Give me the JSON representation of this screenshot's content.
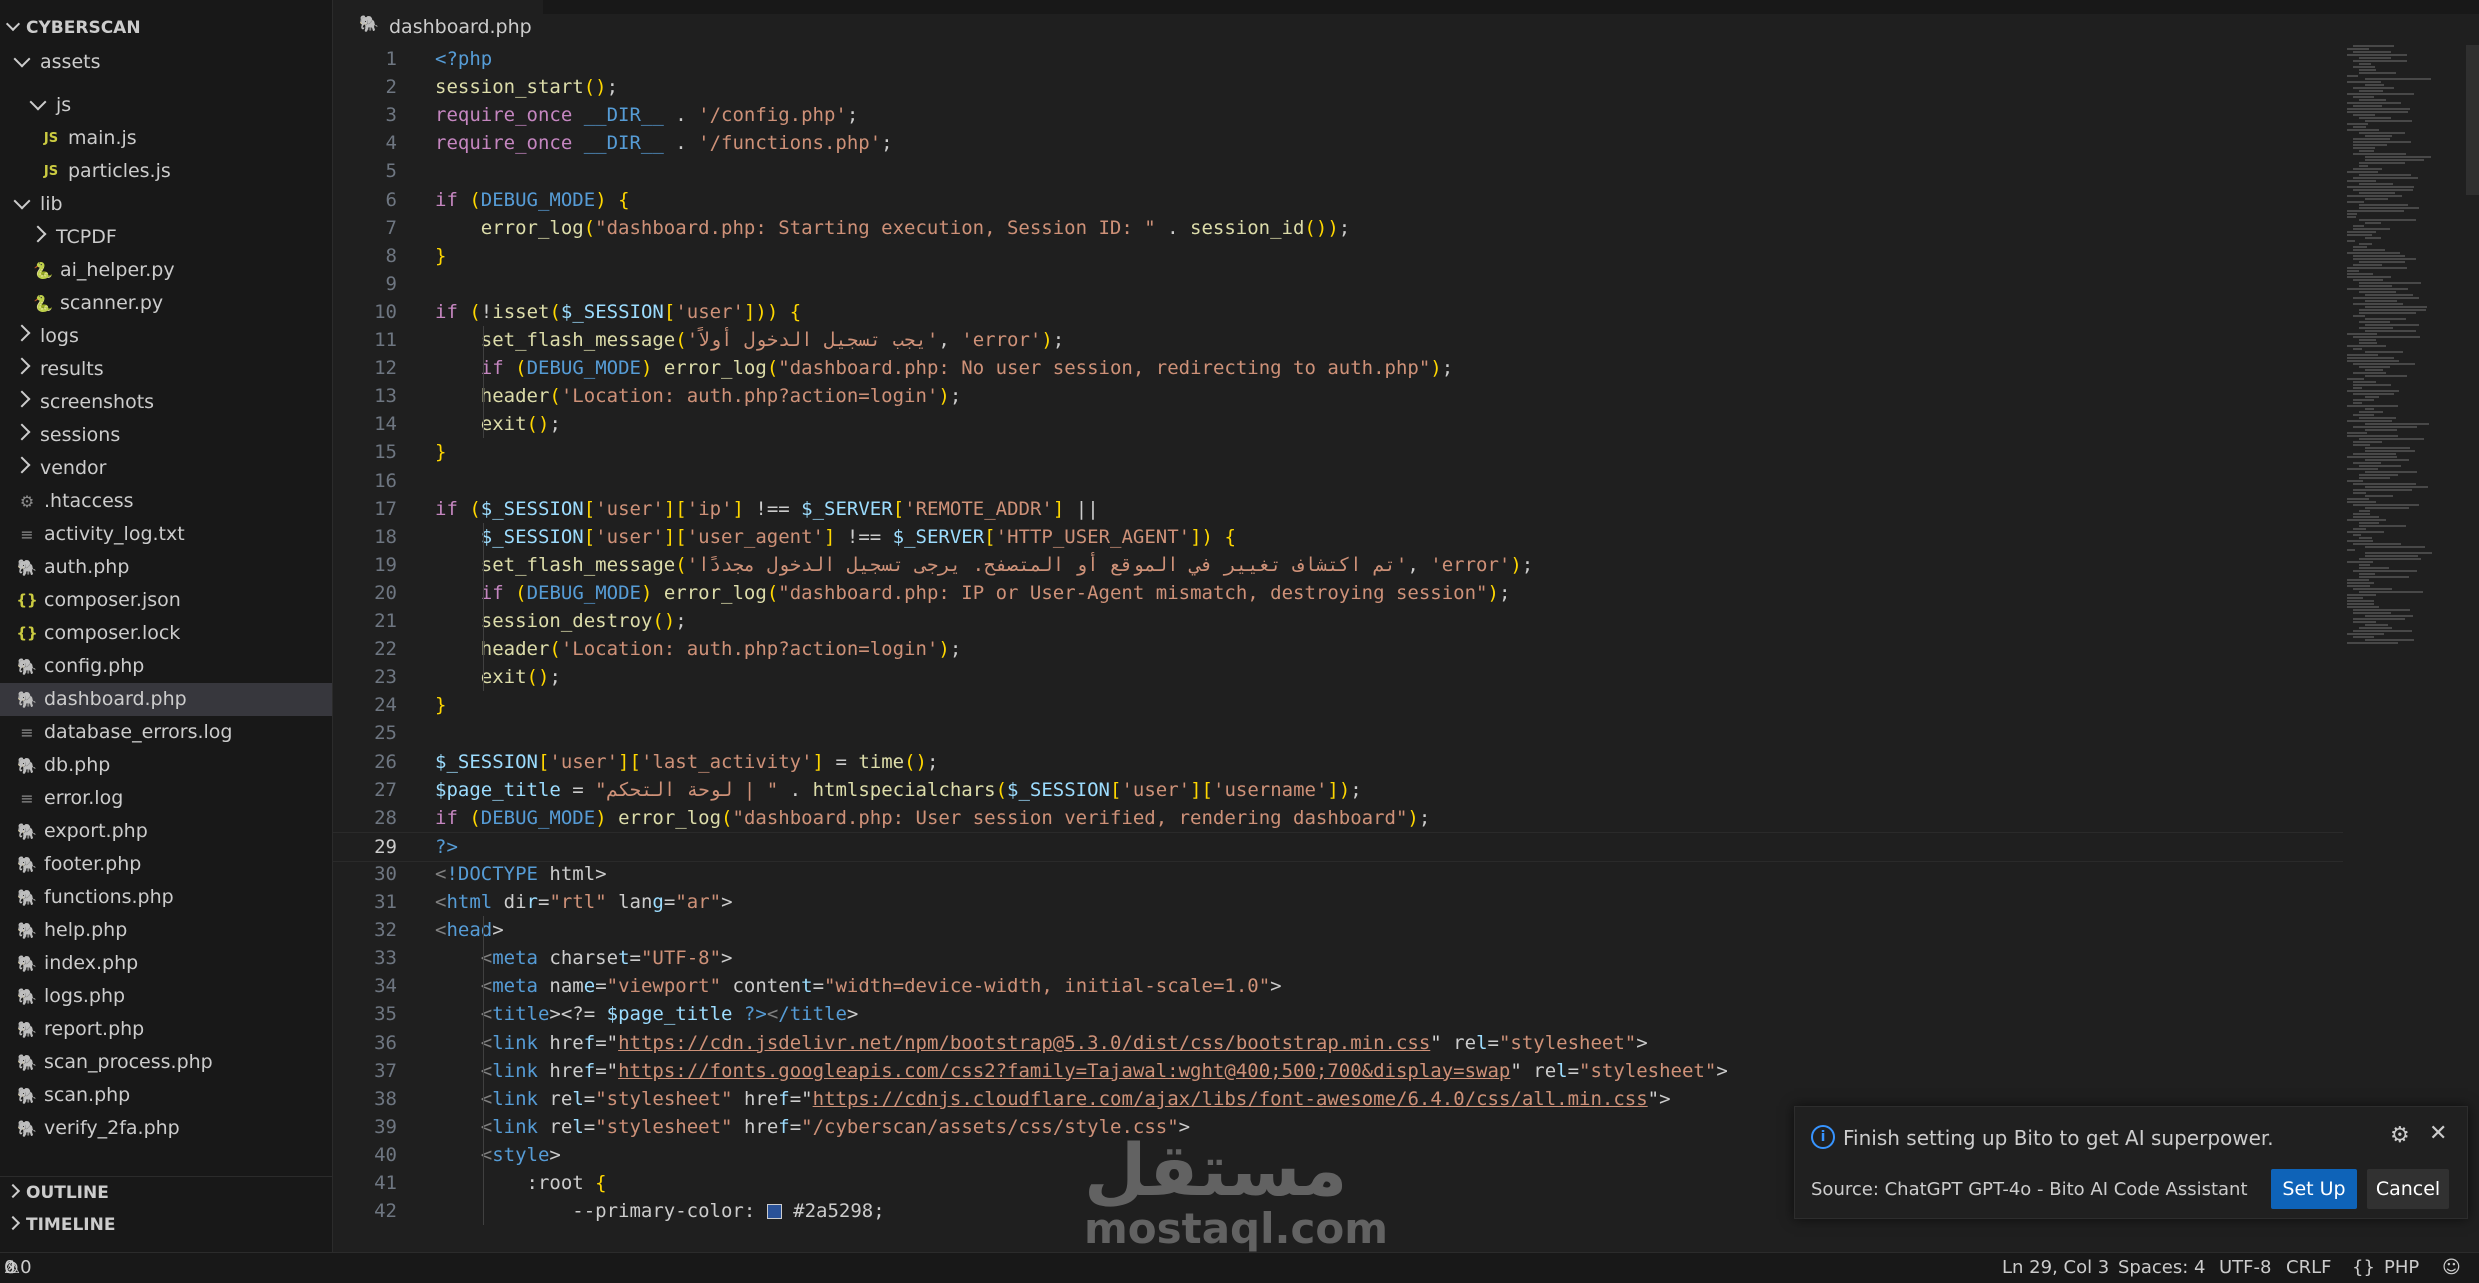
{
  "sidebar": {
    "root": "CYBERSCAN",
    "items": [
      {
        "label": "assets",
        "kind": "folder-open"
      },
      {
        "label": "js",
        "kind": "folder-open"
      },
      {
        "label": "main.js",
        "kind": "js"
      },
      {
        "label": "particles.js",
        "kind": "js"
      },
      {
        "label": "lib",
        "kind": "folder-open"
      },
      {
        "label": "TCPDF",
        "kind": "folder"
      },
      {
        "label": "ai_helper.py",
        "kind": "py"
      },
      {
        "label": "scanner.py",
        "kind": "py"
      },
      {
        "label": "logs",
        "kind": "folder"
      },
      {
        "label": "results",
        "kind": "folder"
      },
      {
        "label": "screenshots",
        "kind": "folder"
      },
      {
        "label": "sessions",
        "kind": "folder"
      },
      {
        "label": "vendor",
        "kind": "folder"
      },
      {
        "label": ".htaccess",
        "kind": "gear"
      },
      {
        "label": "activity_log.txt",
        "kind": "text"
      },
      {
        "label": "auth.php",
        "kind": "php"
      },
      {
        "label": "composer.json",
        "kind": "json"
      },
      {
        "label": "composer.lock",
        "kind": "json"
      },
      {
        "label": "config.php",
        "kind": "php"
      },
      {
        "label": "dashboard.php",
        "kind": "php"
      },
      {
        "label": "database_errors.log",
        "kind": "text"
      },
      {
        "label": "db.php",
        "kind": "php"
      },
      {
        "label": "error.log",
        "kind": "text"
      },
      {
        "label": "export.php",
        "kind": "php"
      },
      {
        "label": "footer.php",
        "kind": "php"
      },
      {
        "label": "functions.php",
        "kind": "php"
      },
      {
        "label": "help.php",
        "kind": "php"
      },
      {
        "label": "index.php",
        "kind": "php"
      },
      {
        "label": "logs.php",
        "kind": "php"
      },
      {
        "label": "report.php",
        "kind": "php"
      },
      {
        "label": "scan_process.php",
        "kind": "php"
      },
      {
        "label": "scan.php",
        "kind": "php"
      },
      {
        "label": "verify_2fa.php",
        "kind": "php"
      }
    ],
    "selected": "dashboard.php",
    "outline_label": "OUTLINE",
    "timeline_label": "TIMELINE"
  },
  "editor": {
    "tab_label": "dashboard.php",
    "current_line": 29,
    "lines": [
      "<?php",
      "session_start();",
      "require_once __DIR__ . '/config.php';",
      "require_once __DIR__ . '/functions.php';",
      "",
      "if (DEBUG_MODE) {",
      "    error_log(\"dashboard.php: Starting execution, Session ID: \" . session_id());",
      "}",
      "",
      "if (!isset($_SESSION['user'])) {",
      "    set_flash_message('يجب تسجيل الدخول أولاً', 'error');",
      "    if (DEBUG_MODE) error_log(\"dashboard.php: No user session, redirecting to auth.php\");",
      "    header('Location: auth.php?action=login');",
      "    exit();",
      "}",
      "",
      "if ($_SESSION['user']['ip'] !== $_SERVER['REMOTE_ADDR'] ||",
      "    $_SESSION['user']['user_agent'] !== $_SERVER['HTTP_USER_AGENT']) {",
      "    set_flash_message('تم اكتشاف تغيير في الموقع أو المتصفح. يرجى تسجيل الدخول مجددًا', 'error');",
      "    if (DEBUG_MODE) error_log(\"dashboard.php: IP or User-Agent mismatch, destroying session\");",
      "    session_destroy();",
      "    header('Location: auth.php?action=login');",
      "    exit();",
      "}",
      "",
      "$_SESSION['user']['last_activity'] = time();",
      "$page_title = \"لوحة التحكم | \" . htmlspecialchars($_SESSION['user']['username']);",
      "if (DEBUG_MODE) error_log(\"dashboard.php: User session verified, rendering dashboard\");",
      "?>",
      "<!DOCTYPE html>",
      "<html dir=\"rtl\" lang=\"ar\">",
      "<head>",
      "    <meta charset=\"UTF-8\">",
      "    <meta name=\"viewport\" content=\"width=device-width, initial-scale=1.0\">",
      "    <title><?= $page_title ?></title>",
      "    <link href=\"https://cdn.jsdelivr.net/npm/bootstrap@5.3.0/dist/css/bootstrap.min.css\" rel=\"stylesheet\">",
      "    <link href=\"https://fonts.googleapis.com/css2?family=Tajawal:wght@400;500;700&display=swap\" rel=\"stylesheet\">",
      "    <link rel=\"stylesheet\" href=\"https://cdnjs.cloudflare.com/ajax/libs/font-awesome/6.4.0/css/all.min.css\">",
      "    <link rel=\"stylesheet\" href=\"/cyberscan/assets/css/style.css\">",
      "    <style>",
      "        :root {",
      "            --primary-color: #2a5298;"
    ]
  },
  "notification": {
    "message": "Finish setting up Bito to get AI superpower.",
    "source": "Source: ChatGPT GPT-4o - Bito AI Code Assistant",
    "setup_label": "Set Up",
    "cancel_label": "Cancel"
  },
  "watermark": {
    "arabic": "مستقل",
    "latin": "mostaql.com"
  },
  "statusbar": {
    "errors": "0",
    "warnings": "0",
    "position": "Ln 29, Col 3",
    "spaces": "Spaces: 4",
    "encoding": "UTF-8",
    "eol": "CRLF",
    "language": "PHP"
  },
  "colors": {
    "accent": "#0e63b8",
    "swatch": "#2a5298"
  }
}
